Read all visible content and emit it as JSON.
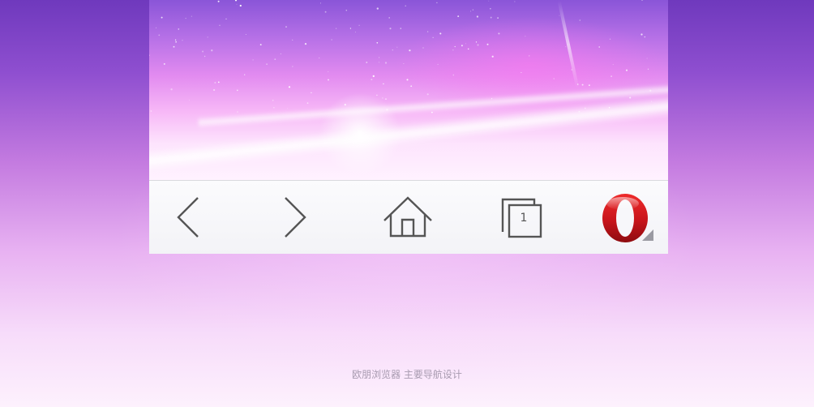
{
  "toolbar": {
    "buttons": [
      {
        "id": "back",
        "icon": "chevron-left-icon"
      },
      {
        "id": "forward",
        "icon": "chevron-right-icon"
      },
      {
        "id": "home",
        "icon": "home-icon"
      },
      {
        "id": "tabs",
        "icon": "tabs-icon",
        "count": "1"
      },
      {
        "id": "menu",
        "icon": "opera-logo-icon"
      }
    ]
  },
  "caption": "欧朋浏览器 主要导航设计",
  "colors": {
    "icon_stroke": "#555555",
    "opera_red": "#c8151b",
    "toolbar_bg": "#f5f5f8",
    "background_top": "#6f39bd",
    "background_bottom": "#fdf1fd"
  }
}
